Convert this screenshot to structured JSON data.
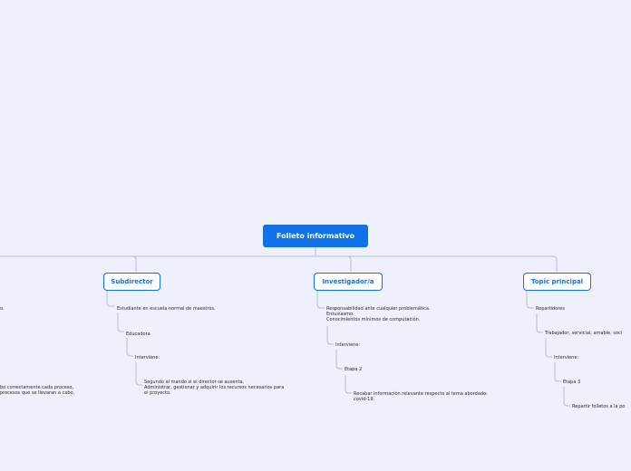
{
  "root": {
    "label": "Folleto informativo"
  },
  "left_partial": {
    "line1": "o.",
    "line2": "bo correctamente cada proceso,",
    "line3": "procesos que se llevaran a cabo,"
  },
  "subdirector": {
    "label": "Subdirector",
    "desc": "Estudiante en escuela normal de maestros.",
    "role": "Educadora",
    "interviene": "Interviene:",
    "detail": "Segundo al mando si el director se ausenta.\nAdministrar, gestionar y adquirir los recursos necesarios para\nel proyecto."
  },
  "investigador": {
    "label": "Investigador/a",
    "desc": "Responsabilidad ante cualquier problemática.\nEntusiasmo.\nConocimientos mínimos de computación.",
    "interviene": "Interviene:",
    "etapa": "Etapa 2",
    "detail": "Recabar información relevante respecto al tema abordado:\ncovid-19."
  },
  "topic": {
    "label": "Topic principal",
    "role": "Repartidores",
    "desc": "Trabajador, servicial, amable, soci",
    "interviene": "Interviene:",
    "etapa": "Etapa 3",
    "detail": "Repartir folletos a la po"
  }
}
